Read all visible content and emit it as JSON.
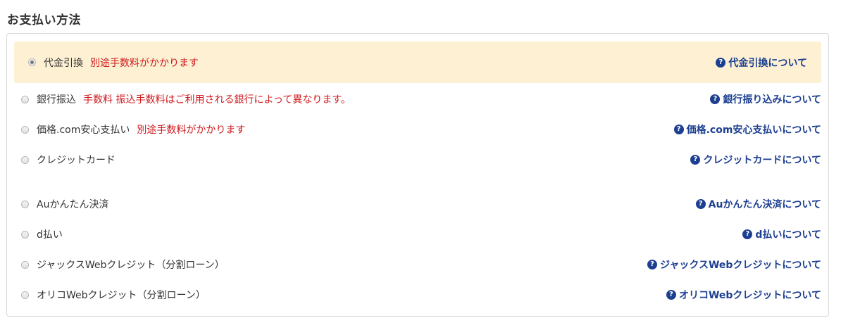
{
  "title": "お支払い方法",
  "methods": [
    {
      "label": "代金引換",
      "note": "別途手数料がかかります",
      "help": "代金引換について",
      "checked": true
    },
    {
      "label": "銀行振込",
      "note": "手数料 振込手数料はご利用される銀行によって異なります。",
      "help": "銀行振り込みについて",
      "checked": false
    },
    {
      "label": "価格.com安心支払い",
      "note": "別途手数料がかかります",
      "help": "価格.com安心支払いについて",
      "checked": false
    },
    {
      "label": "クレジットカード",
      "note": "",
      "help": "クレジットカードについて",
      "checked": false
    },
    {
      "label": "Auかんたん決済",
      "note": "",
      "help": "Auかんたん決済について",
      "checked": false
    },
    {
      "label": "d払い",
      "note": "",
      "help": "d払いについて",
      "checked": false
    },
    {
      "label": "ジャックスWebクレジット（分割ローン）",
      "note": "",
      "help": "ジャックスWebクレジットについて",
      "checked": false
    },
    {
      "label": "オリコWebクレジット（分割ローン）",
      "note": "",
      "help": "オリコWebクレジットについて",
      "checked": false
    }
  ],
  "help_icon": "question-circle-icon",
  "colors": {
    "note": "#d0191d",
    "link": "#1d3f91",
    "selected_bg": "#fdf0d3"
  }
}
